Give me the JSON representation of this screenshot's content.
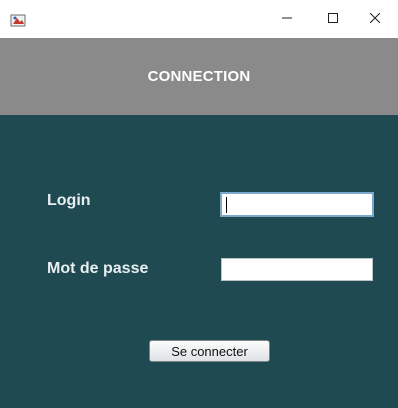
{
  "titlebar": {
    "icon": "java-app-icon",
    "minimize_icon": "minimize-icon",
    "maximize_icon": "maximize-icon",
    "close_icon": "close-icon"
  },
  "header": {
    "title": "CONNECTION"
  },
  "form": {
    "login_label": "Login",
    "login_value": "",
    "password_label": "Mot de passe",
    "password_value": "",
    "submit_label": "Se connecter"
  },
  "colors": {
    "header_bg": "#8a8a8a",
    "panel_bg": "#1f4a52",
    "label_text": "#e8eef0",
    "focus_border": "#7aa9c9"
  }
}
